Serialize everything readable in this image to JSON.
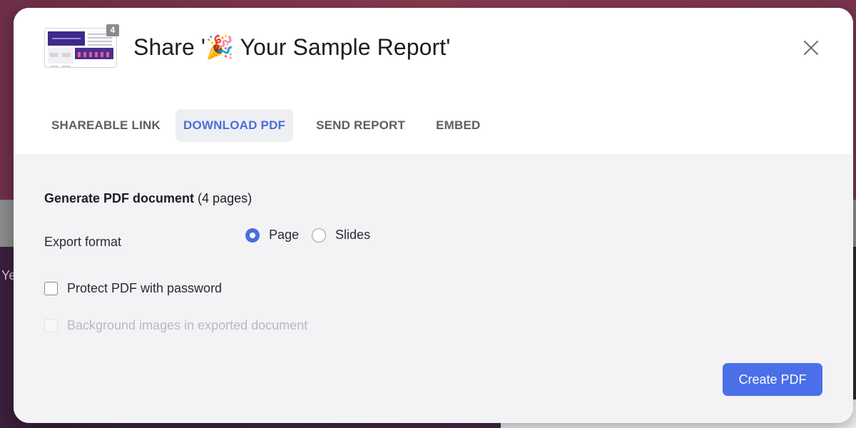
{
  "background": {
    "stub_text": "Ye"
  },
  "modal": {
    "page_badge": "4",
    "title": "Share '🎉 Your Sample Report'",
    "close_icon": "close-icon"
  },
  "tabs": [
    {
      "label": "SHAREABLE LINK",
      "active": false
    },
    {
      "label": "DOWNLOAD PDF",
      "active": true
    },
    {
      "label": "SEND REPORT",
      "active": false
    },
    {
      "label": "EMBED",
      "active": false
    }
  ],
  "panel": {
    "heading_bold": "Generate PDF document",
    "heading_rest": " (4 pages)",
    "export_label": "Export format",
    "export_options": [
      {
        "label": "Page",
        "checked": true
      },
      {
        "label": "Slides",
        "checked": false
      }
    ],
    "protect_label": "Protect PDF with password",
    "protect_checked": false,
    "background_label": "Background images in exported document",
    "background_disabled": true,
    "create_button": "Create PDF"
  },
  "colors": {
    "accent": "#4b6fe8",
    "active_tab_text": "#4a6ed9",
    "active_tab_bg": "#eeeff3",
    "panel_bg": "#f3f3f5"
  }
}
